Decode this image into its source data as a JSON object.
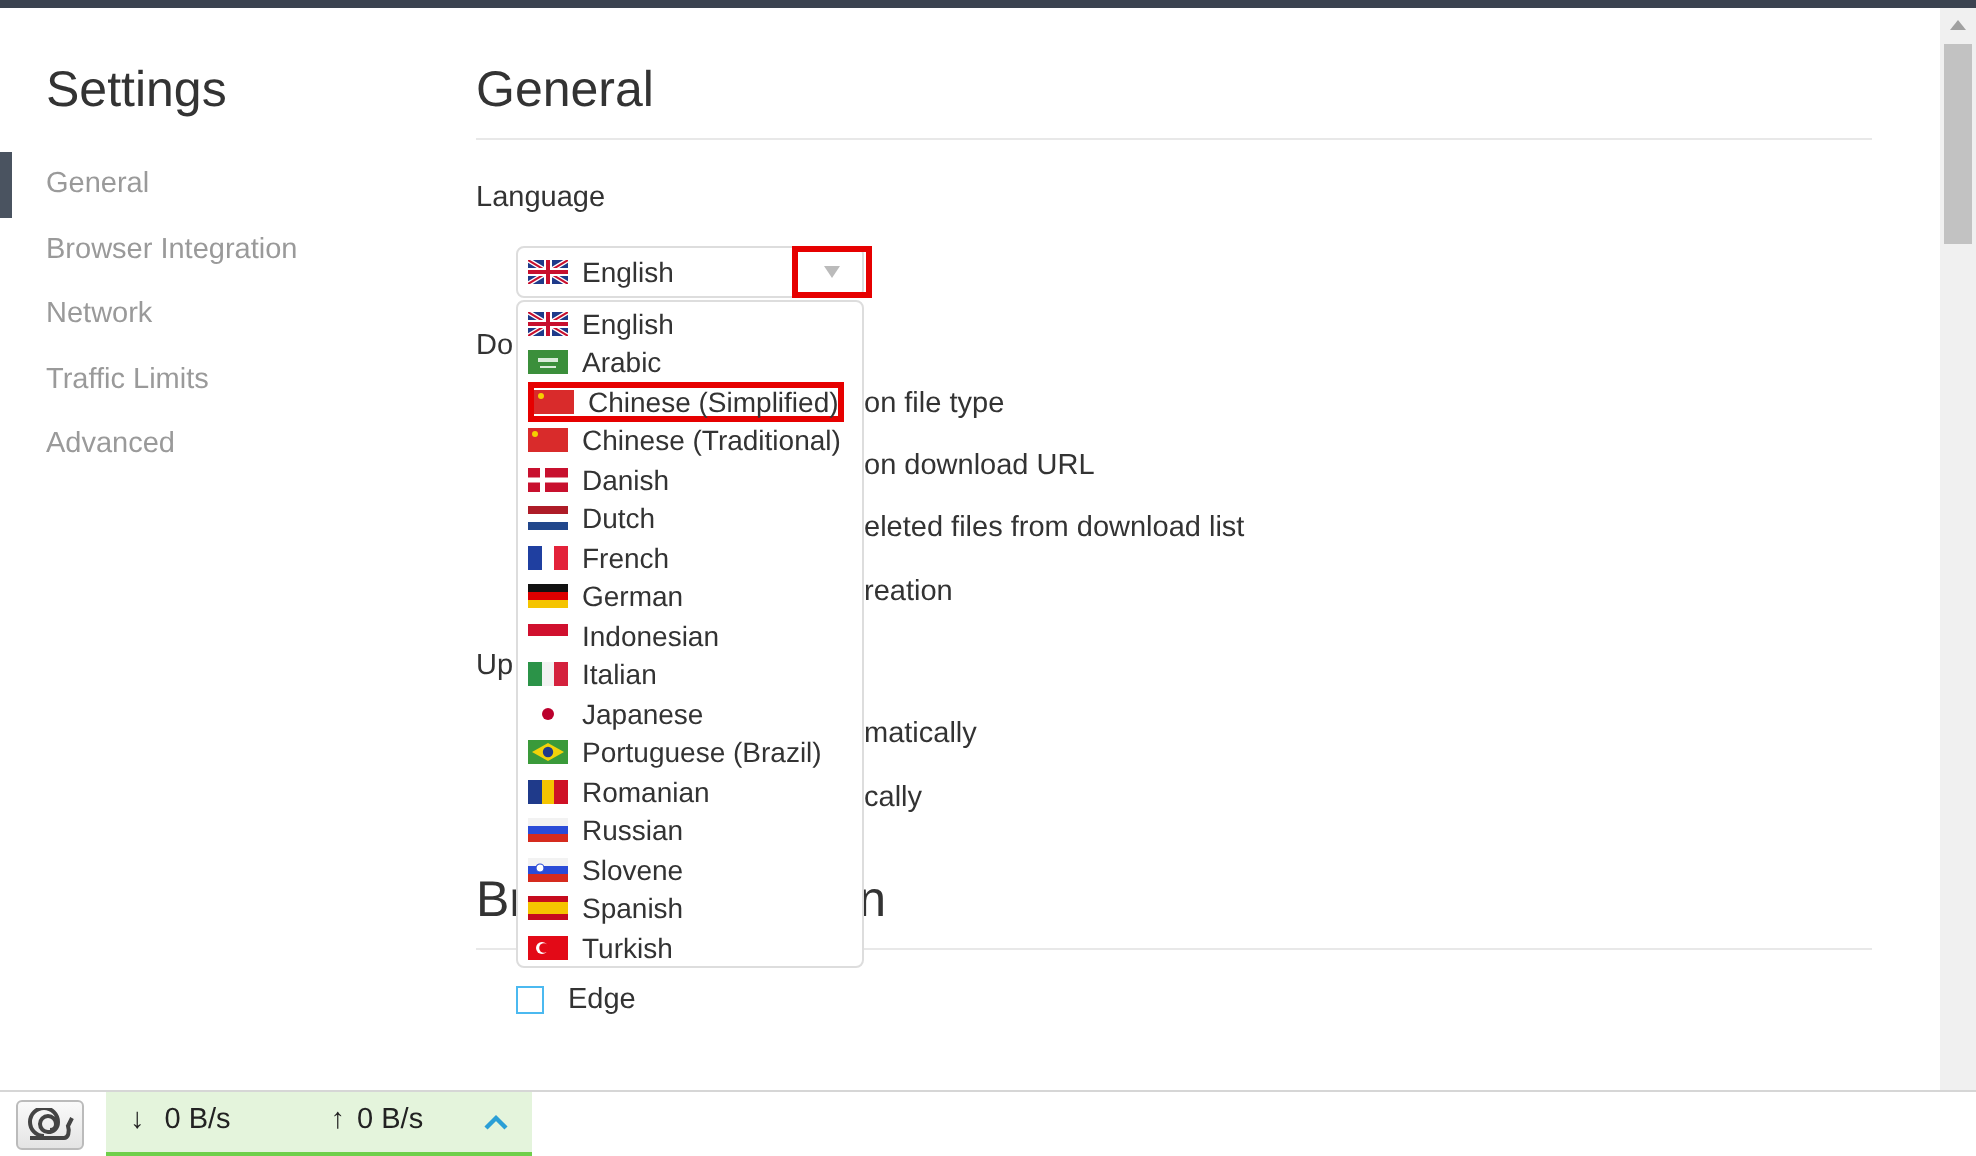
{
  "sidebar": {
    "title": "Settings",
    "items": [
      {
        "label": "General",
        "selected": true
      },
      {
        "label": "Browser Integration",
        "selected": false
      },
      {
        "label": "Network",
        "selected": false
      },
      {
        "label": "Traffic Limits",
        "selected": false
      },
      {
        "label": "Advanced",
        "selected": false
      }
    ]
  },
  "main": {
    "heading": "General",
    "language_label": "Language",
    "downloads_heading_fragment": "Do",
    "downloads_option_fragments": [
      "on file type",
      "on download URL",
      "eleted files from download list",
      "reation"
    ],
    "updates_heading_fragment": "Up",
    "updates_option_fragments": [
      "matically",
      "cally"
    ],
    "browser_heading_fragments": [
      "Br",
      "n"
    ],
    "browser_options": [
      {
        "label": "Edge",
        "checked": false
      }
    ]
  },
  "language_dropdown": {
    "value": "English",
    "caret_highlighted": true,
    "options": [
      {
        "label": "English",
        "highlighted": false
      },
      {
        "label": "Arabic",
        "highlighted": false
      },
      {
        "label": "Chinese (Simplified)",
        "highlighted": true
      },
      {
        "label": "Chinese (Traditional)",
        "highlighted": false
      },
      {
        "label": "Danish",
        "highlighted": false
      },
      {
        "label": "Dutch",
        "highlighted": false
      },
      {
        "label": "French",
        "highlighted": false
      },
      {
        "label": "German",
        "highlighted": false
      },
      {
        "label": "Indonesian",
        "highlighted": false
      },
      {
        "label": "Italian",
        "highlighted": false
      },
      {
        "label": "Japanese",
        "highlighted": false
      },
      {
        "label": "Portuguese (Brazil)",
        "highlighted": false
      },
      {
        "label": "Romanian",
        "highlighted": false
      },
      {
        "label": "Russian",
        "highlighted": false
      },
      {
        "label": "Slovene",
        "highlighted": false
      },
      {
        "label": "Spanish",
        "highlighted": false
      },
      {
        "label": "Turkish",
        "highlighted": false
      }
    ]
  },
  "status_bar": {
    "download_arrow": "↓",
    "download_speed": "0 B/s",
    "upload_arrow": "↑",
    "upload_speed": "0 B/s"
  }
}
